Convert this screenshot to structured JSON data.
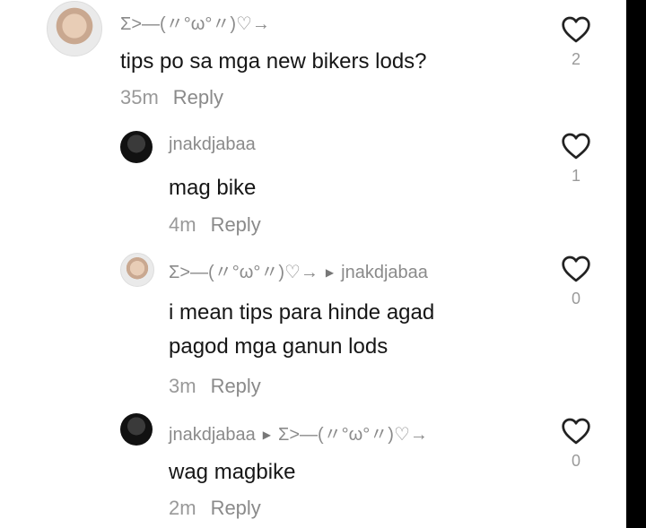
{
  "comments": [
    {
      "username": "Σ>―(〃°ω°〃)♡→",
      "reply_to": "",
      "text_lines": [
        "tips po sa mga new bikers lods?"
      ],
      "time": "35m",
      "reply_label": "Reply",
      "likes": "2",
      "avatar": "user-photo"
    },
    {
      "username": "jnakdjabaa",
      "reply_to": "",
      "text_lines": [
        "mag bike"
      ],
      "time": "4m",
      "reply_label": "Reply",
      "likes": "1",
      "avatar": "dark-photo"
    },
    {
      "username": "Σ>―(〃°ω°〃)♡→",
      "reply_to": "jnakdjabaa",
      "text_lines": [
        "i mean tips para hinde agad",
        "pagod mga ganun lods"
      ],
      "time": "3m",
      "reply_label": "Reply",
      "likes": "0",
      "avatar": "user-photo"
    },
    {
      "username": "jnakdjabaa",
      "reply_to": "Σ>―(〃°ω°〃)♡→",
      "text_lines": [
        "wag magbike"
      ],
      "time": "2m",
      "reply_label": "Reply",
      "likes": "0",
      "avatar": "dark-photo"
    }
  ],
  "icons": {
    "like": "heart-outline-icon",
    "reply_arrow": "triangle-right-icon"
  },
  "colors": {
    "background": "#ffffff",
    "border": "#000000",
    "muted_text": "#8a8a8a",
    "body_text": "#161616"
  }
}
